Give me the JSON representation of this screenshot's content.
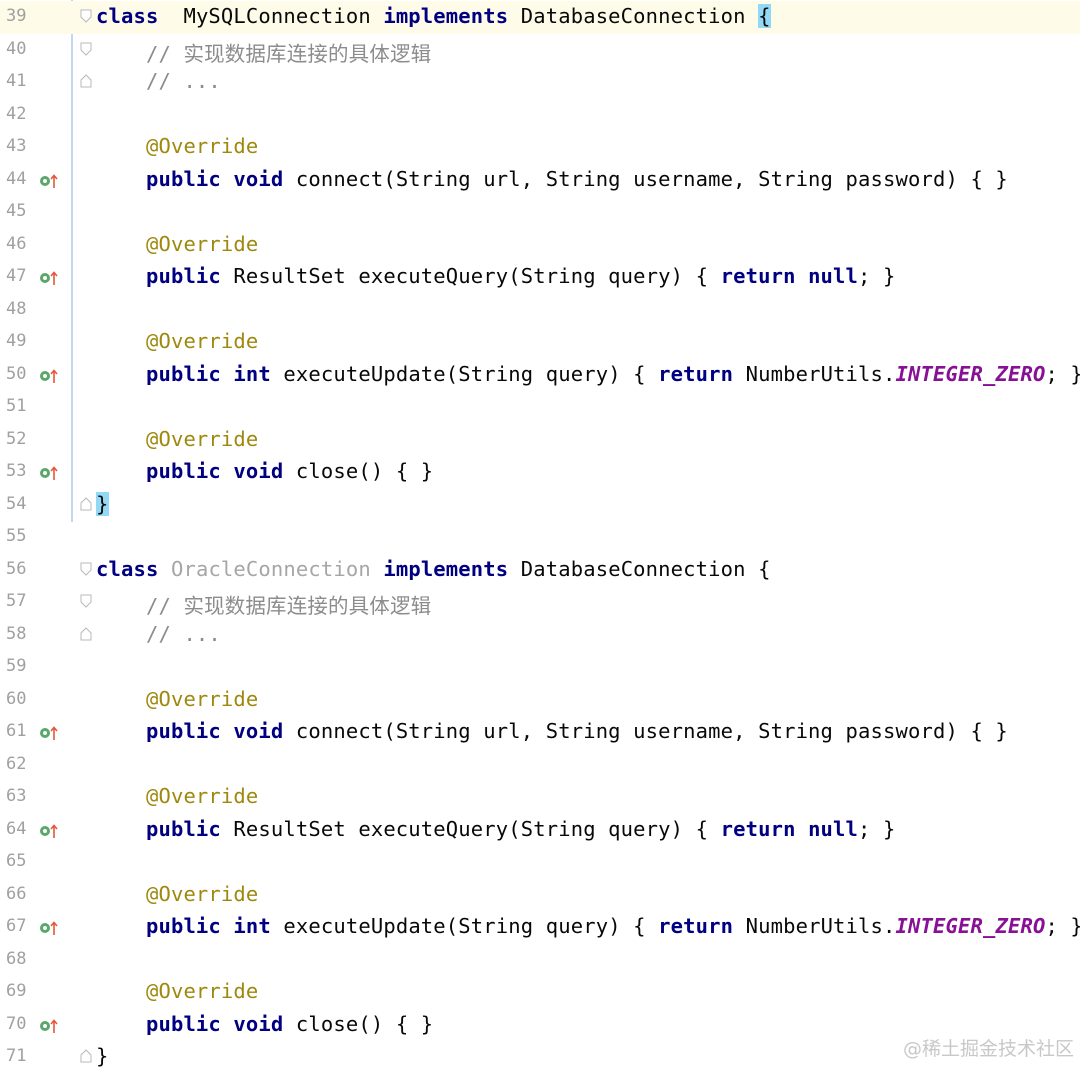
{
  "editor": {
    "lines": [
      {
        "num": "39",
        "highlight": true,
        "icon": false,
        "fold": "open",
        "tokens": [
          [
            "kwp",
            "class"
          ],
          [
            "",
            "  "
          ],
          [
            "",
            "MySQLConnection "
          ],
          [
            "kwp",
            "implements"
          ],
          [
            "",
            " DatabaseConnection "
          ],
          [
            "bracket",
            "{"
          ]
        ]
      },
      {
        "num": "40",
        "icon": false,
        "fold": "mid",
        "tokens": [
          [
            "",
            "    "
          ],
          [
            "cm",
            "// 实现数据库连接的具体逻辑"
          ]
        ]
      },
      {
        "num": "41",
        "icon": false,
        "fold": "end",
        "tokens": [
          [
            "",
            "    "
          ],
          [
            "cm",
            "// ..."
          ]
        ]
      },
      {
        "num": "42",
        "icon": false,
        "tokens": []
      },
      {
        "num": "43",
        "icon": false,
        "tokens": [
          [
            "",
            "    "
          ],
          [
            "an",
            "@Override"
          ]
        ]
      },
      {
        "num": "44",
        "icon": true,
        "tokens": [
          [
            "",
            "    "
          ],
          [
            "kwp",
            "public"
          ],
          [
            "",
            " "
          ],
          [
            "kwp",
            "void"
          ],
          [
            "",
            " connect(String url, String username, String password) { }"
          ]
        ]
      },
      {
        "num": "45",
        "icon": false,
        "tokens": []
      },
      {
        "num": "46",
        "icon": false,
        "tokens": [
          [
            "",
            "    "
          ],
          [
            "an",
            "@Override"
          ]
        ]
      },
      {
        "num": "47",
        "icon": true,
        "tokens": [
          [
            "",
            "    "
          ],
          [
            "kwp",
            "public"
          ],
          [
            "",
            " ResultSet executeQuery(String query) { "
          ],
          [
            "kwp",
            "return"
          ],
          [
            "",
            " "
          ],
          [
            "kwp",
            "null"
          ],
          [
            "",
            "; }"
          ]
        ]
      },
      {
        "num": "48",
        "icon": false,
        "tokens": []
      },
      {
        "num": "49",
        "icon": false,
        "tokens": [
          [
            "",
            "    "
          ],
          [
            "an",
            "@Override"
          ]
        ]
      },
      {
        "num": "50",
        "icon": true,
        "tokens": [
          [
            "",
            "    "
          ],
          [
            "kwp",
            "public"
          ],
          [
            "",
            " "
          ],
          [
            "kwp",
            "int"
          ],
          [
            "",
            " executeUpdate(String query) { "
          ],
          [
            "kwp",
            "return"
          ],
          [
            "",
            " NumberUtils."
          ],
          [
            "const",
            "INTEGER_ZERO"
          ],
          [
            "",
            "; }"
          ]
        ]
      },
      {
        "num": "51",
        "icon": false,
        "tokens": []
      },
      {
        "num": "52",
        "icon": false,
        "tokens": [
          [
            "",
            "    "
          ],
          [
            "an",
            "@Override"
          ]
        ]
      },
      {
        "num": "53",
        "icon": true,
        "tokens": [
          [
            "",
            "    "
          ],
          [
            "kwp",
            "public"
          ],
          [
            "",
            " "
          ],
          [
            "kwp",
            "void"
          ],
          [
            "",
            " close() { }"
          ]
        ]
      },
      {
        "num": "54",
        "icon": false,
        "fold": "end",
        "tokens": [
          [
            "bracket",
            "}"
          ]
        ]
      },
      {
        "num": "55",
        "icon": false,
        "tokens": []
      },
      {
        "num": "56",
        "icon": false,
        "fold": "open",
        "tokens": [
          [
            "kwp",
            "class"
          ],
          [
            "",
            " "
          ],
          [
            "cls-dim",
            "OracleConnection"
          ],
          [
            "",
            " "
          ],
          [
            "kwp",
            "implements"
          ],
          [
            "",
            " DatabaseConnection {"
          ]
        ]
      },
      {
        "num": "57",
        "icon": false,
        "fold": "mid",
        "tokens": [
          [
            "",
            "    "
          ],
          [
            "cm",
            "// 实现数据库连接的具体逻辑"
          ]
        ]
      },
      {
        "num": "58",
        "icon": false,
        "fold": "end",
        "tokens": [
          [
            "",
            "    "
          ],
          [
            "cm",
            "// ..."
          ]
        ]
      },
      {
        "num": "59",
        "icon": false,
        "tokens": []
      },
      {
        "num": "60",
        "icon": false,
        "tokens": [
          [
            "",
            "    "
          ],
          [
            "an",
            "@Override"
          ]
        ]
      },
      {
        "num": "61",
        "icon": true,
        "tokens": [
          [
            "",
            "    "
          ],
          [
            "kwp",
            "public"
          ],
          [
            "",
            " "
          ],
          [
            "kwp",
            "void"
          ],
          [
            "",
            " connect(String url, String username, String password) { }"
          ]
        ]
      },
      {
        "num": "62",
        "icon": false,
        "tokens": []
      },
      {
        "num": "63",
        "icon": false,
        "tokens": [
          [
            "",
            "    "
          ],
          [
            "an",
            "@Override"
          ]
        ]
      },
      {
        "num": "64",
        "icon": true,
        "tokens": [
          [
            "",
            "    "
          ],
          [
            "kwp",
            "public"
          ],
          [
            "",
            " ResultSet executeQuery(String query) { "
          ],
          [
            "kwp",
            "return"
          ],
          [
            "",
            " "
          ],
          [
            "kwp",
            "null"
          ],
          [
            "",
            "; }"
          ]
        ]
      },
      {
        "num": "65",
        "icon": false,
        "tokens": []
      },
      {
        "num": "66",
        "icon": false,
        "tokens": [
          [
            "",
            "    "
          ],
          [
            "an",
            "@Override"
          ]
        ]
      },
      {
        "num": "67",
        "icon": true,
        "tokens": [
          [
            "",
            "    "
          ],
          [
            "kwp",
            "public"
          ],
          [
            "",
            " "
          ],
          [
            "kwp",
            "int"
          ],
          [
            "",
            " executeUpdate(String query) { "
          ],
          [
            "kwp",
            "return"
          ],
          [
            "",
            " NumberUtils."
          ],
          [
            "const",
            "INTEGER_ZERO"
          ],
          [
            "",
            "; }"
          ]
        ]
      },
      {
        "num": "68",
        "icon": false,
        "tokens": []
      },
      {
        "num": "69",
        "icon": false,
        "tokens": [
          [
            "",
            "    "
          ],
          [
            "an",
            "@Override"
          ]
        ]
      },
      {
        "num": "70",
        "icon": true,
        "tokens": [
          [
            "",
            "    "
          ],
          [
            "kwp",
            "public"
          ],
          [
            "",
            " "
          ],
          [
            "kwp",
            "void"
          ],
          [
            "",
            " close() { }"
          ]
        ]
      },
      {
        "num": "71",
        "icon": false,
        "fold": "end",
        "tokens": [
          [
            "",
            "}"
          ]
        ]
      }
    ]
  },
  "watermark": "@稀土掘金技术社区",
  "icons": {
    "gutter": "implements-method-icon",
    "fold": "fold-icon"
  },
  "colors": {
    "keyword": "#000080",
    "comment": "#8c8c8c",
    "annotation": "#9e880d",
    "constant": "#871094",
    "bracket_highlight": "#93d9f5",
    "gutter_icon": "#59a869"
  }
}
